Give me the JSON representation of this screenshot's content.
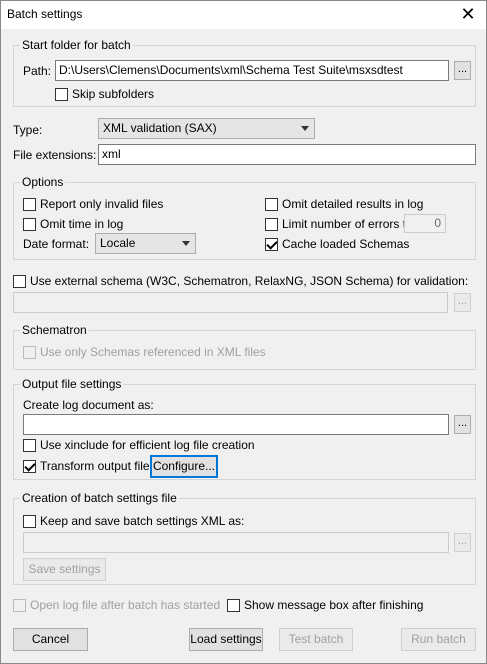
{
  "window": {
    "title": "Batch settings",
    "close_glyph": "✕"
  },
  "start_folder": {
    "legend": "Start folder for batch",
    "path_label": "Path:",
    "path_value": "D:\\Users\\Clemens\\Documents\\xml\\Schema Test Suite\\msxsdtest",
    "browse_label": "...",
    "skip_subfolders": {
      "label": "Skip subfolders",
      "checked": false
    }
  },
  "type": {
    "label": "Type:",
    "selected": "XML validation (SAX)"
  },
  "file_extensions": {
    "label": "File extensions:",
    "value": "xml"
  },
  "options": {
    "legend": "Options",
    "report_invalid": {
      "label": "Report only invalid files",
      "checked": false
    },
    "omit_time": {
      "label": "Omit time in log",
      "checked": false
    },
    "date_format_label": "Date format:",
    "date_format_selected": "Locale",
    "omit_detailed": {
      "label": "Omit detailed results in log",
      "checked": false
    },
    "limit_errors": {
      "label": "Limit number of errors to",
      "checked": false,
      "value": "0"
    },
    "cache_schemas": {
      "label": "Cache loaded Schemas",
      "checked": true
    }
  },
  "external_schema": {
    "label": "Use external schema (W3C, Schematron, RelaxNG, JSON Schema) for validation:",
    "checked": false,
    "path_value": "",
    "browse_label": "..."
  },
  "schematron": {
    "legend": "Schematron",
    "only_referenced": {
      "label": "Use only Schemas referenced in XML files",
      "checked": false
    }
  },
  "output": {
    "legend": "Output file settings",
    "create_log_label": "Create log document as:",
    "log_path_value": "",
    "browse_label": "...",
    "xinclude": {
      "label": "Use xinclude for efficient log file creation",
      "checked": false
    },
    "transform": {
      "label": "Transform output file",
      "checked": true
    },
    "configure_label": "Configure..."
  },
  "batch_file": {
    "legend": "Creation of batch settings file",
    "keep_save": {
      "label": "Keep and save batch settings XML as:",
      "checked": false
    },
    "path_value": "",
    "browse_label": "...",
    "save_settings_label": "Save settings"
  },
  "bottom": {
    "open_log": {
      "label": "Open log file after batch has started",
      "checked": false
    },
    "show_message": {
      "label": "Show message box after finishing",
      "checked": false
    }
  },
  "buttons": {
    "cancel": "Cancel",
    "load_settings": "Load settings",
    "test_batch": "Test batch",
    "run_batch": "Run batch"
  }
}
